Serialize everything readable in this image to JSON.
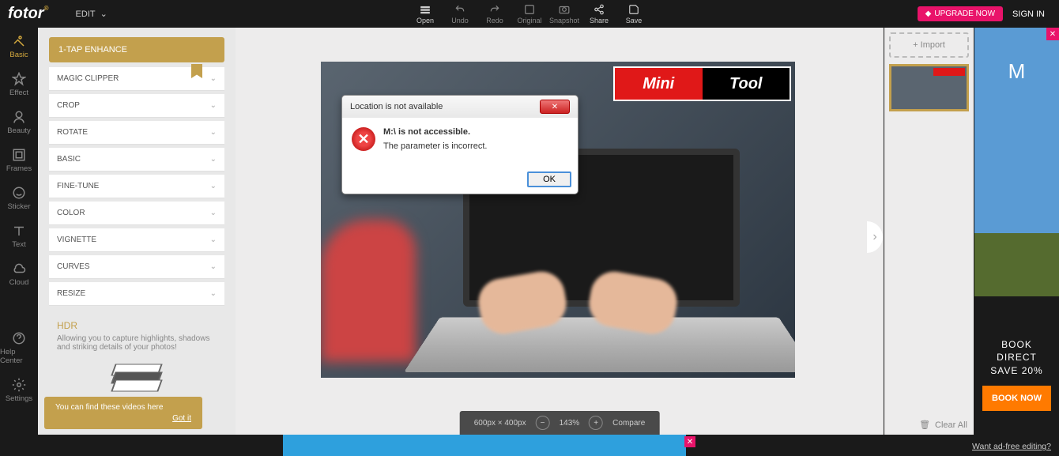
{
  "brand": "fotor",
  "edit_menu": "EDIT",
  "topbar": {
    "open": "Open",
    "undo": "Undo",
    "redo": "Redo",
    "original": "Original",
    "snapshot": "Snapshot",
    "share": "Share",
    "save": "Save"
  },
  "upgrade": "UPGRADE NOW",
  "signin": "SIGN IN",
  "sidebar": {
    "basic": "Basic",
    "effect": "Effect",
    "beauty": "Beauty",
    "frames": "Frames",
    "sticker": "Sticker",
    "text": "Text",
    "cloud": "Cloud",
    "help": "Help Center",
    "settings": "Settings"
  },
  "panel": {
    "enhance": "1-TAP ENHANCE",
    "tools": [
      "MAGIC CLIPPER",
      "CROP",
      "ROTATE",
      "BASIC",
      "FINE-TUNE",
      "COLOR",
      "VIGNETTE",
      "CURVES",
      "RESIZE"
    ],
    "hdr_title": "HDR",
    "hdr_desc": "Allowing you to capture highlights, shadows and striking details of your photos!"
  },
  "tooltip": {
    "text": "You can find these videos here",
    "dismiss": "Got it"
  },
  "dialog": {
    "title": "Location is not available",
    "line1": "M:\\ is not accessible.",
    "line2": "The parameter is incorrect.",
    "ok": "OK"
  },
  "minitool": {
    "left": "Mini",
    "right": "Tool"
  },
  "import_btn": "Import",
  "bottombar": {
    "dims": "600px × 400px",
    "zoom": "143%",
    "compare": "Compare"
  },
  "clear_all": "Clear All",
  "ad": {
    "line1": "BOOK",
    "line2": "DIRECT",
    "line3": "SAVE 20%",
    "cta": "BOOK NOW"
  },
  "footer_text": "Want ad-free editing?"
}
